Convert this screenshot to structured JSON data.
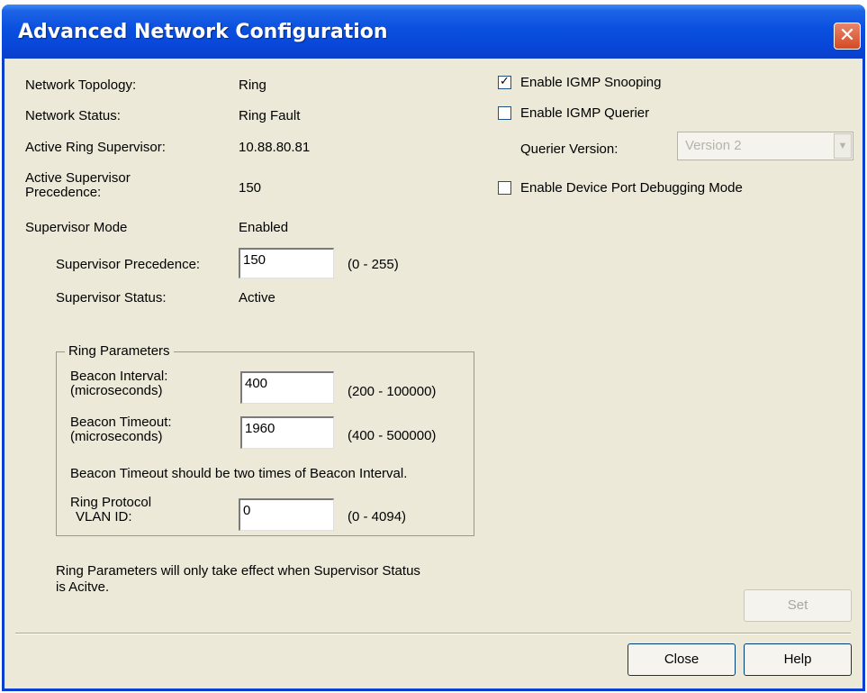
{
  "window": {
    "title": "Advanced Network Configuration",
    "close_glyph": "✕"
  },
  "info": {
    "topology_label": "Network Topology:",
    "topology_value": "Ring",
    "status_label": "Network Status:",
    "status_value": "Ring Fault",
    "supervisor_label": "Active Ring Supervisor:",
    "supervisor_value": "10.88.80.81",
    "precedence_label_line1": "Active Supervisor",
    "precedence_label_line2": "Precedence:",
    "precedence_value": "150",
    "mode_label": "Supervisor Mode",
    "mode_value": "Enabled"
  },
  "supervisor": {
    "precedence_label": "Supervisor Precedence:",
    "precedence_value": "150",
    "precedence_range": "(0 - 255)",
    "status_label": "Supervisor Status:",
    "status_value": "Active"
  },
  "ring_params": {
    "title": "Ring Parameters",
    "beacon_interval_label1": "Beacon Interval:",
    "beacon_interval_label2": "(microseconds)",
    "beacon_interval_value": "400",
    "beacon_interval_range": "(200 - 100000)",
    "beacon_timeout_label1": "Beacon Timeout:",
    "beacon_timeout_label2": "(microseconds)",
    "beacon_timeout_value": "1960",
    "beacon_timeout_range": "(400 - 500000)",
    "note": "Beacon Timeout should be two times of Beacon Interval.",
    "vlan_label1": "Ring Protocol",
    "vlan_label2": "VLAN ID:",
    "vlan_value": "0",
    "vlan_range": "(0 - 4094)"
  },
  "footer_note_line1": "Ring Parameters will only take effect when Supervisor Status",
  "footer_note_line2": "is Acitve.",
  "options": {
    "igmp_snooping_label": "Enable IGMP Snooping",
    "igmp_snooping_checked": true,
    "igmp_snooping_mark": "✓",
    "igmp_querier_label": "Enable IGMP Querier",
    "igmp_querier_checked": false,
    "querier_version_label": "Querier Version:",
    "querier_version_value": "Version 2",
    "dropdown_glyph": "▼",
    "debug_mode_label": "Enable Device Port Debugging Mode",
    "debug_mode_checked": false
  },
  "buttons": {
    "set": "Set",
    "close": "Close",
    "help": "Help"
  },
  "colors": {
    "title_bar": "#0a50df",
    "dialog_bg": "#ece9d8",
    "close_button": "#d44a23"
  }
}
